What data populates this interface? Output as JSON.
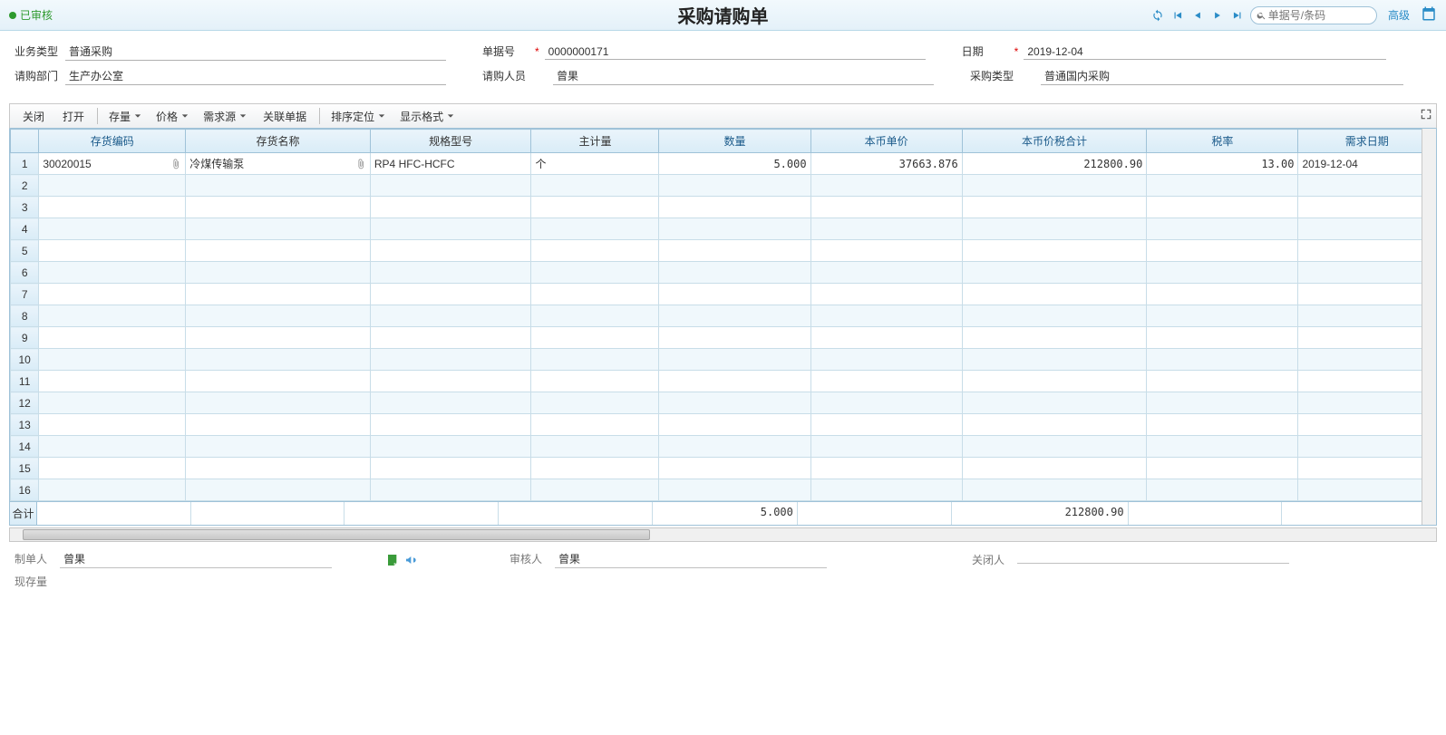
{
  "header": {
    "status": "已审核",
    "title": "采购请购单",
    "search_placeholder": "单据号/条码",
    "advanced": "高级"
  },
  "form": {
    "business_type_label": "业务类型",
    "business_type": "普通采购",
    "doc_no_label": "单据号",
    "doc_no": "0000000171",
    "date_label": "日期",
    "date": "2019-12-04",
    "dept_label": "请购部门",
    "dept": "生产办公室",
    "person_label": "请购人员",
    "person": "曾果",
    "purchase_type_label": "采购类型",
    "purchase_type": "普通国内采购"
  },
  "toolbar": {
    "close": "关闭",
    "open": "打开",
    "stock": "存量",
    "price": "价格",
    "demand": "需求源",
    "related": "关联单据",
    "sort": "排序定位",
    "display": "显示格式"
  },
  "columns": {
    "code": "存货编码",
    "name": "存货名称",
    "spec": "规格型号",
    "main_unit": "主计量",
    "qty": "数量",
    "price": "本币单价",
    "amount": "本币价税合计",
    "tax": "税率",
    "req_date": "需求日期"
  },
  "rows": [
    {
      "code": "30020015",
      "name": "冷煤传输泵",
      "spec": "RP4 HFC-HCFC",
      "unit": "个",
      "qty": "5.000",
      "price": "37663.876",
      "amount": "212800.90",
      "tax": "13.00",
      "req_date": "2019-12-04"
    }
  ],
  "totals": {
    "label": "合计",
    "qty": "5.000",
    "amount": "212800.90"
  },
  "footer": {
    "maker_label": "制单人",
    "maker": "曾果",
    "auditor_label": "审核人",
    "auditor": "曾果",
    "closer_label": "关闭人",
    "closer": "",
    "stock_label": "现存量"
  }
}
